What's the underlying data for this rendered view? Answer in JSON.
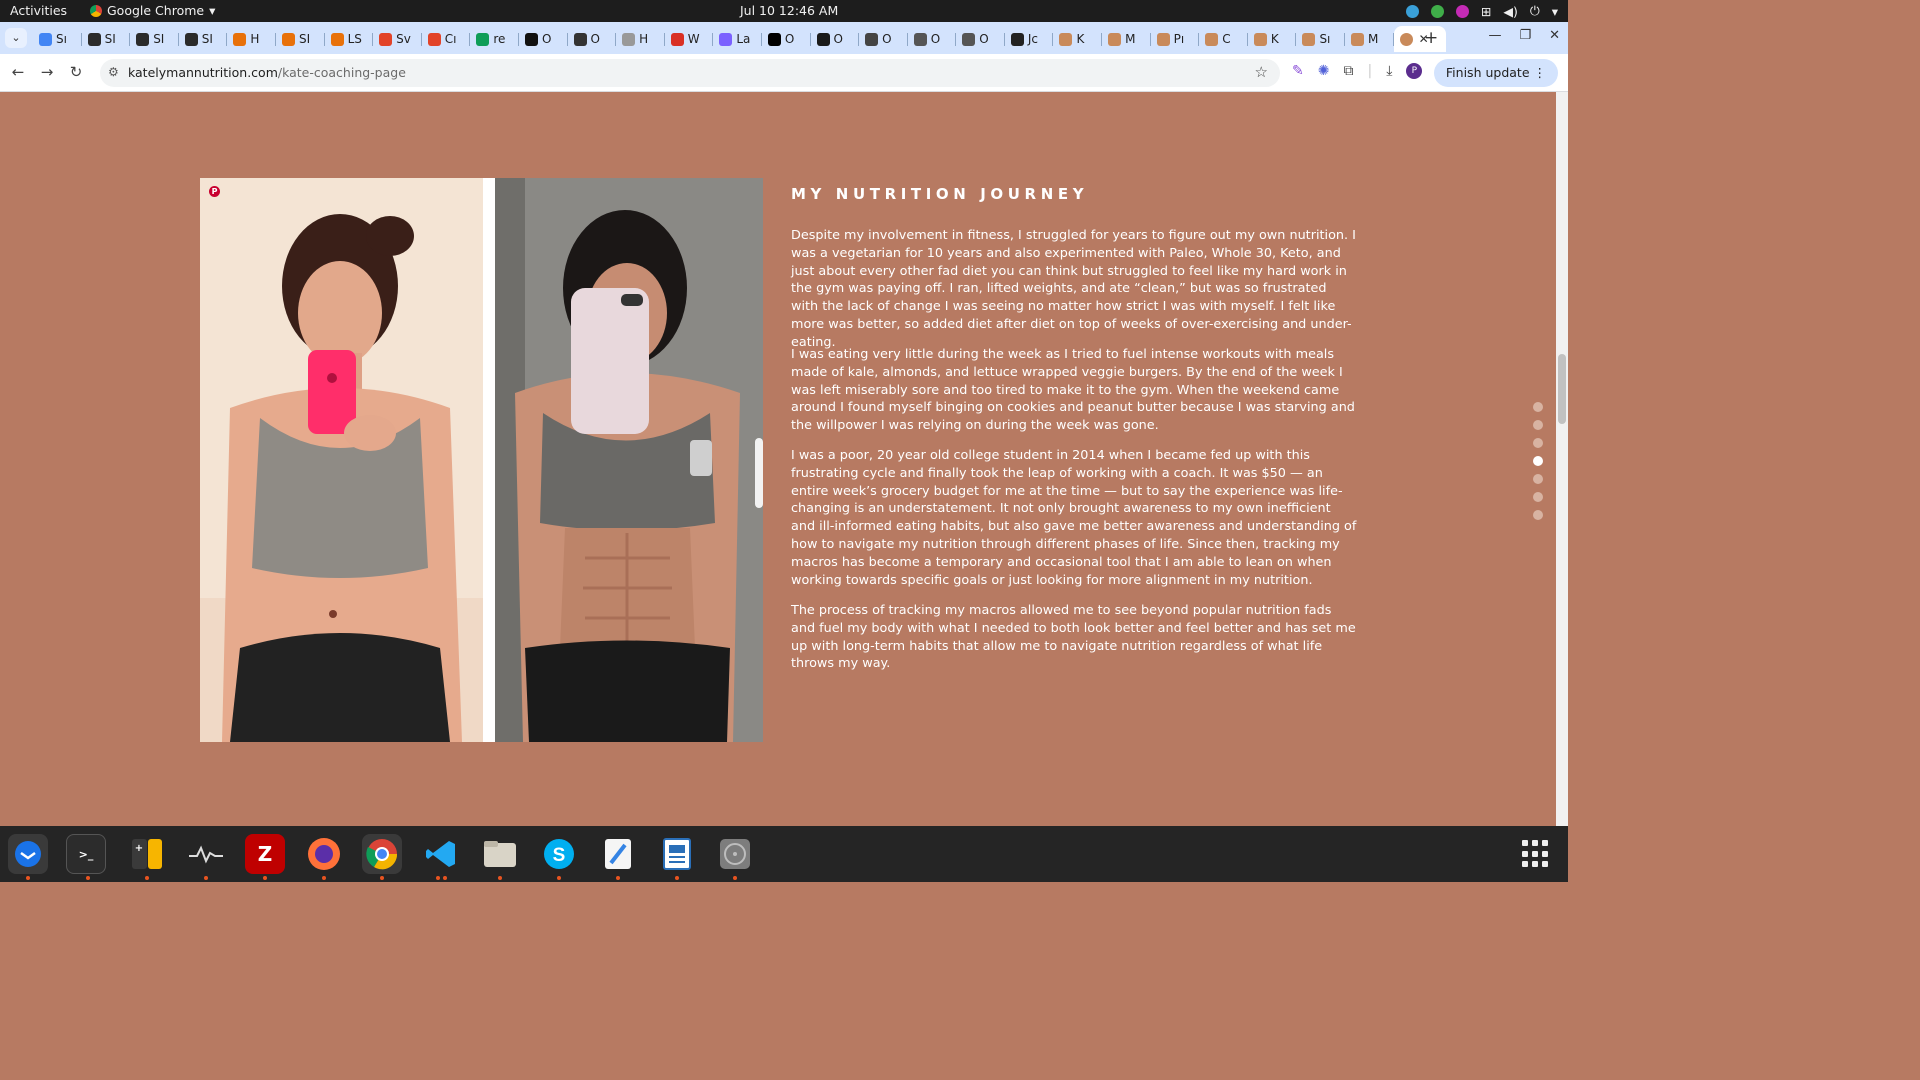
{
  "system_bar": {
    "activities": "Activities",
    "app_name": "Google Chrome",
    "clock": "Jul 10  12:46 AM"
  },
  "tabs": [
    {
      "label": "Sı",
      "color": "#4285f4"
    },
    {
      "label": "SI",
      "color": "#2b2b2b"
    },
    {
      "label": "SI",
      "color": "#2b2b2b"
    },
    {
      "label": "SI",
      "color": "#2b2b2b"
    },
    {
      "label": "H",
      "color": "#e8710a"
    },
    {
      "label": "SI",
      "color": "#e8710a"
    },
    {
      "label": "LS",
      "color": "#e8710a"
    },
    {
      "label": "Sv",
      "color": "#e24329"
    },
    {
      "label": "Cı",
      "color": "#e24329"
    },
    {
      "label": "re",
      "color": "#0f9d58"
    },
    {
      "label": "O",
      "color": "#111111"
    },
    {
      "label": "O",
      "color": "#333333"
    },
    {
      "label": "H",
      "color": "#999999"
    },
    {
      "label": "W",
      "color": "#d93025"
    },
    {
      "label": "La",
      "color": "#7b61ff"
    },
    {
      "label": "O",
      "color": "#000000"
    },
    {
      "label": "O",
      "color": "#1a1a1a"
    },
    {
      "label": "O",
      "color": "#444444"
    },
    {
      "label": "O",
      "color": "#555555"
    },
    {
      "label": "O",
      "color": "#555555"
    },
    {
      "label": "Jc",
      "color": "#222222"
    },
    {
      "label": "K",
      "color": "#c98a5a"
    },
    {
      "label": "M",
      "color": "#c98a5a"
    },
    {
      "label": "Pı",
      "color": "#c98a5a"
    },
    {
      "label": "C",
      "color": "#c98a5a"
    },
    {
      "label": "K",
      "color": "#c98a5a"
    },
    {
      "label": "Sı",
      "color": "#c98a5a"
    },
    {
      "label": "M",
      "color": "#c98a5a"
    }
  ],
  "active_tab": {
    "color": "#c98a5a",
    "close": "✕"
  },
  "toolbar": {
    "url_host": "katelymannutrition.com",
    "url_path": "/kate-coaching-page",
    "finish_update": "Finish update",
    "profile_initial": "P"
  },
  "page": {
    "heading": "MY NUTRITION JOURNEY",
    "paragraphs": [
      "Despite my involvement in fitness, I struggled for years to figure out my own nutrition. I was a vegetarian for 10 years and also experimented with Paleo, Whole 30, Keto, and just about every other fad diet you can think but struggled to feel like my hard work in the gym was paying off. I ran, lifted weights, and ate “clean,” but was so frustrated with the lack of change I was seeing no matter how strict I was with myself. I felt like more was better, so added diet after diet on top of weeks of over-exercising and under-eating.",
      "I was eating very little during the week as I tried to fuel intense workouts with meals made of kale, almonds, and lettuce wrapped veggie burgers. By the end of the week I was left miserably sore and too tired to make it to the gym. When the weekend came around I found myself binging on cookies and peanut butter because I was starving and the willpower I was relying on during the week was gone.",
      "I was a poor, 20 year old college student in 2014 when I became fed up with this frustrating cycle and finally took the leap of working with a coach. It was $50 — an entire week’s grocery budget for me at the time — but to say the experience was life-changing is an understatement. It not only brought awareness to my own inefficient and ill-informed eating habits, but also gave me better awareness and understanding of how to navigate my nutrition through different phases of life. Since then, tracking my macros has become a temporary and occasional tool that I am able to lean on when working towards specific goals or just looking for more alignment in my nutrition.",
      "The process of tracking my macros allowed me to see beyond popular nutrition fads and fuel my body with what I needed to both look better and feel better and has set me up with long-term habits that allow me to navigate nutrition regardless of what life throws my way."
    ],
    "background_color": "#b77a62",
    "section_dots_count": 7,
    "active_section_index": 3
  },
  "dock": {
    "apps": [
      "thunderbird",
      "terminal",
      "calculator",
      "system-monitor",
      "filezilla",
      "firefox",
      "chrome",
      "vscode",
      "files",
      "skype",
      "text-editor",
      "document-viewer",
      "disc"
    ]
  }
}
